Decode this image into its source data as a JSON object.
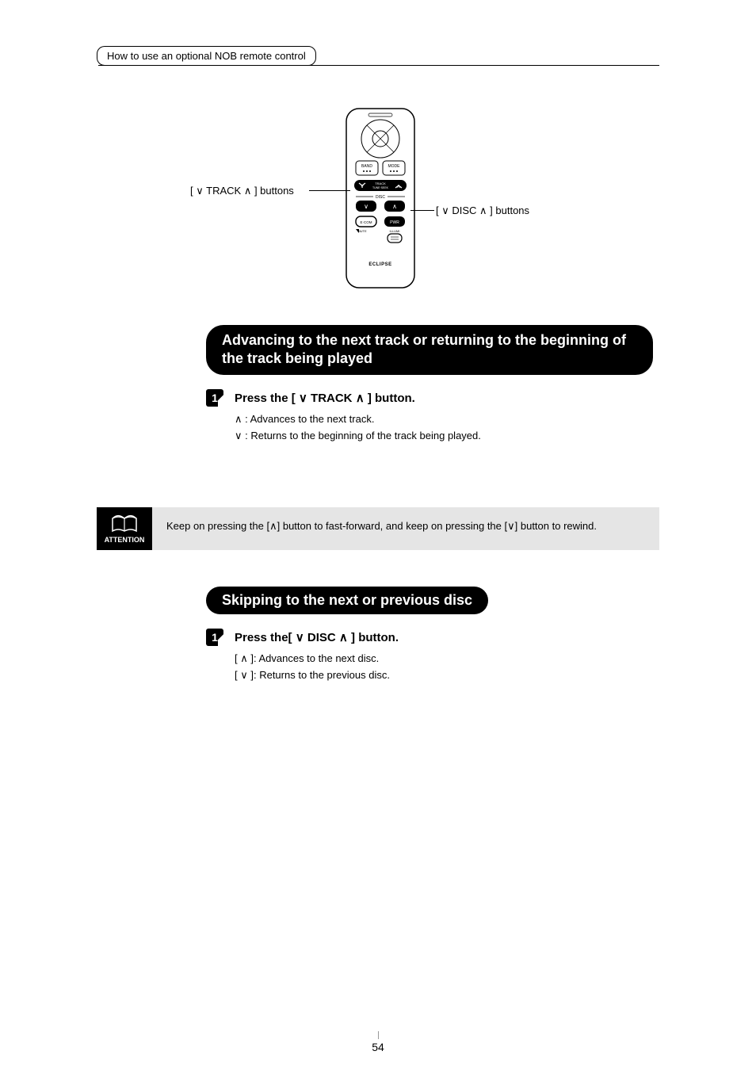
{
  "breadcrumb": "How to use an optional NOB remote control",
  "remote": {
    "label_left_prefix": "[ ",
    "label_left_mid": " TRACK ",
    "label_left_suffix": " ] buttons",
    "label_right_prefix": "[ ",
    "label_right_mid": " DISC ",
    "label_right_suffix": " ] buttons",
    "btn_band": "BAND",
    "btn_mode": "MODE",
    "track_label": "TRACK",
    "tune_label": "TUNE·SEEK",
    "disc_label": "DISC",
    "ecom_label": "E·COM",
    "pwr_label": "PWR",
    "mute_label": "MUTE",
    "illumi_label": "ILLUMI",
    "brand": "ECLIPSE"
  },
  "section1": {
    "heading": "Advancing to the next track or returning to the beginning of the track being played",
    "step_num": "1",
    "step_prefix": "Press the [ ",
    "step_mid": " TRACK ",
    "step_suffix": " ] button.",
    "bullet1_prefix": "",
    "bullet1_text": " : Advances to the next track.",
    "bullet2_prefix": "",
    "bullet2_text": " : Returns to the beginning of the track being played."
  },
  "attention": {
    "label": "ATTENTION",
    "text_a": "Keep on pressing the [",
    "text_b": "] button to fast-forward, and keep on pressing the [",
    "text_c": "] button to rewind."
  },
  "section2": {
    "heading": "Skipping to the next or previous disc",
    "step_num": "1",
    "step_prefix": "Press the[ ",
    "step_mid": " DISC ",
    "step_suffix": " ] button.",
    "bullet1_prefix": "[ ",
    "bullet1_suffix": " ]: Advances to the next disc.",
    "bullet2_prefix": "[ ",
    "bullet2_suffix": " ]: Returns to the previous disc."
  },
  "page": "54"
}
